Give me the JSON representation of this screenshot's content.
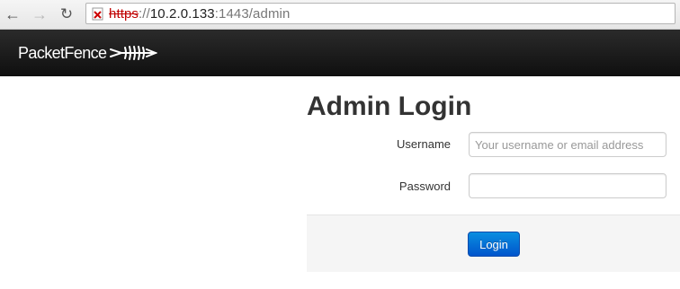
{
  "browser": {
    "url_scheme": "https",
    "url_separator": "://",
    "url_host": "10.2.0.133",
    "url_rest": ":1443/admin"
  },
  "navbar": {
    "brand": "PacketFence"
  },
  "login": {
    "title": "Admin Login",
    "username_label": "Username",
    "username_placeholder": "Your username or email address",
    "username_value": "",
    "password_label": "Password",
    "password_value": "",
    "submit_label": "Login"
  },
  "colors": {
    "navbar_bg": "#1a1a1a",
    "button_primary": "#0066cc",
    "insecure_scheme": "#c00000"
  }
}
